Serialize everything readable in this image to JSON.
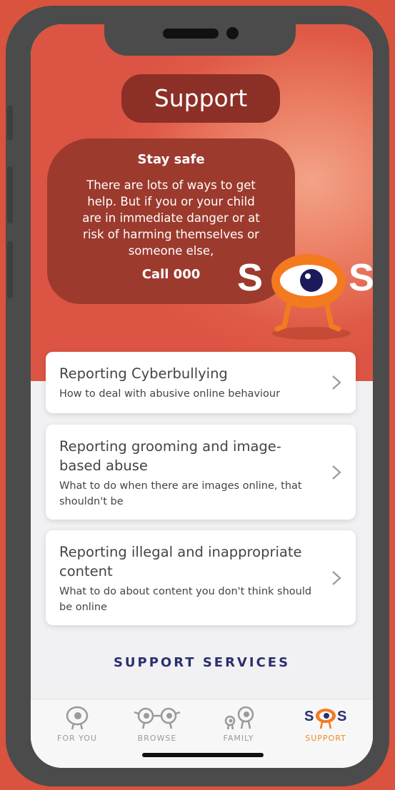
{
  "header": {
    "title": "Support"
  },
  "safety": {
    "title": "Stay safe",
    "body": "There are lots of ways to get help. But if you or your child are in immediate danger or at risk of harming themselves or someone else,",
    "call": "Call 000"
  },
  "mascot": {
    "text": "SOS",
    "icon": "sos-mascot-icon"
  },
  "cards": [
    {
      "title": "Reporting Cyberbullying",
      "subtitle": "How to deal with abusive online behaviour"
    },
    {
      "title": "Reporting grooming and image-based abuse",
      "subtitle": "What to do when there are images online, that shouldn't be"
    },
    {
      "title": "Reporting illegal and inappropriate content",
      "subtitle": "What to do about content you don't think should be online"
    }
  ],
  "support_services": {
    "label": "SUPPORT SERVICES"
  },
  "tabs": [
    {
      "label": "FOR YOU",
      "icon": "single-eye-icon"
    },
    {
      "label": "BROWSE",
      "icon": "glasses-eyes-icon"
    },
    {
      "label": "FAMILY",
      "icon": "family-eyes-icon"
    },
    {
      "label": "SUPPORT",
      "icon": "sos-icon",
      "active": true
    }
  ],
  "colors": {
    "background": "#d9533f",
    "title_pill": "#8c2f27",
    "safety_box": "#9c3a2e",
    "mascot": "#f47a20",
    "support_services": "#2a2f6e",
    "active_tab": "#f08a1c"
  }
}
